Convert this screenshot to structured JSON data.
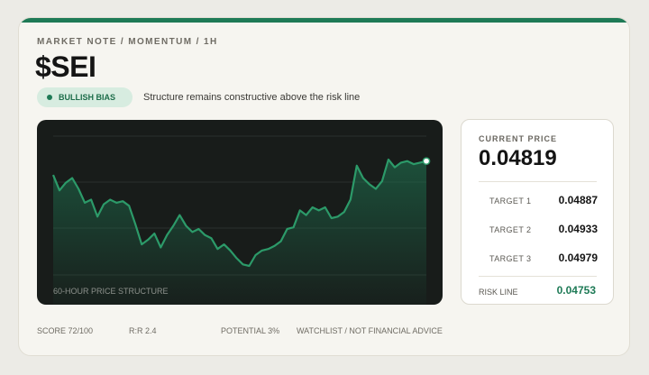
{
  "header": {
    "eyebrow": "MARKET NOTE / MOMENTUM / 1H",
    "ticker": "$SEI",
    "badge_label": "BULLISH BIAS",
    "subline": "Structure remains constructive above the risk line"
  },
  "chart": {
    "caption": "60-HOUR PRICE STRUCTURE"
  },
  "chart_data": {
    "type": "area",
    "line_color": "#2c9a69",
    "values": [
      0.04791,
      0.04781,
      0.04786,
      0.04789,
      0.04782,
      0.04773,
      0.04775,
      0.04764,
      0.04772,
      0.04775,
      0.04773,
      0.04774,
      0.04771,
      0.04759,
      0.04746,
      0.04749,
      0.04753,
      0.04744,
      0.04752,
      0.04758,
      0.04765,
      0.04758,
      0.04754,
      0.04756,
      0.04752,
      0.0475,
      0.04743,
      0.04746,
      0.04742,
      0.04737,
      0.04733,
      0.04732,
      0.04739,
      0.04742,
      0.04743,
      0.04745,
      0.04748,
      0.04756,
      0.04757,
      0.04768,
      0.04765,
      0.0477,
      0.04768,
      0.0477,
      0.04763,
      0.04764,
      0.04767,
      0.04775,
      0.04797,
      0.04789,
      0.04785,
      0.04782,
      0.04787,
      0.04801,
      0.04796,
      0.04799,
      0.048,
      0.04798,
      0.04799,
      0.048
    ]
  },
  "price_panel": {
    "label": "CURRENT PRICE",
    "price": "0.04819",
    "targets": [
      {
        "label": "TARGET 1",
        "value": "0.04887"
      },
      {
        "label": "TARGET 2",
        "value": "0.04933"
      },
      {
        "label": "TARGET 3",
        "value": "0.04979"
      }
    ],
    "risk_label": "RISK LINE",
    "risk_value": "0.04753"
  },
  "footer": {
    "score": "SCORE 72/100",
    "rr": "R:R 2.4",
    "potential": "POTENTIAL 3%",
    "note": "WATCHLIST / NOT FINANCIAL ADVICE"
  },
  "colors": {
    "accent": "#1e7a56",
    "badge_bg": "#d7ece0",
    "chart_bg": "#181c1a"
  }
}
